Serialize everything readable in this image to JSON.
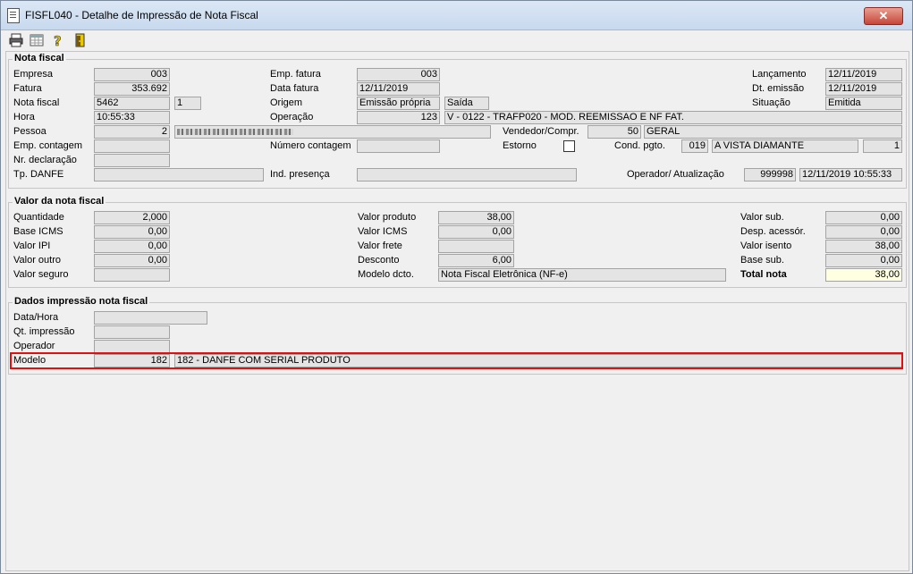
{
  "window": {
    "title": "FISFL040 - Detalhe de Impressão de Nota Fiscal",
    "close": "✕"
  },
  "nf": {
    "section": "Nota fiscal",
    "empresa_l": "Empresa",
    "empresa": "003",
    "fatura_l": "Fatura",
    "fatura": "353.692",
    "nota_l": "Nota fiscal",
    "nota": "5462",
    "nota_serie": "1",
    "hora_l": "Hora",
    "hora": "10:55:33",
    "pessoa_l": "Pessoa",
    "pessoa": "2",
    "empcont_l": "Emp. contagem",
    "nrdecl_l": "Nr. declaração",
    "tpdanfe_l": "Tp. DANFE",
    "empfat_l": "Emp. fatura",
    "empfat": "003",
    "datafat_l": "Data fatura",
    "datafat": "12/11/2019",
    "origem_l": "Origem",
    "origem": "Emissão própria",
    "origem2": "Saída",
    "operacao_l": "Operação",
    "operacao": "123",
    "operacao_desc": "V - 0122 - TRAFP020 - MOD. REEMISSAO  E NF FAT.",
    "numcont_l": "Número contagem",
    "indpres_l": "Ind. presença",
    "vendedor_l": "Vendedor/Compr.",
    "vendedor": "50",
    "vendedor_desc": "GERAL",
    "estorno_l": "Estorno",
    "condpgto_l": "Cond. pgto.",
    "condpgto": "019",
    "condpgto_desc": "A VISTA DIAMANTE",
    "condpgto_n": "1",
    "lanc_l": "Lançamento",
    "lanc": "12/11/2019",
    "dtemis_l": "Dt. emissão",
    "dtemis": "12/11/2019",
    "sit_l": "Situação",
    "sit": "Emitida",
    "oper_l": "Operador/ Atualização",
    "oper": "999998",
    "oper_dt": "12/11/2019 10:55:33"
  },
  "valor": {
    "section": "Valor da nota fiscal",
    "qtd_l": "Quantidade",
    "qtd": "2,000",
    "bicms_l": "Base ICMS",
    "bicms": "0,00",
    "ipi_l": "Valor IPI",
    "ipi": "0,00",
    "outro_l": "Valor outro",
    "outro": "0,00",
    "seguro_l": "Valor seguro",
    "prod_l": "Valor produto",
    "prod": "38,00",
    "vicms_l": "Valor ICMS",
    "vicms": "0,00",
    "frete_l": "Valor frete",
    "desc_l": "Desconto",
    "desc": "6,00",
    "modelo_l": "Modelo dcto.",
    "modelo": "Nota Fiscal Eletrônica (NF-e)",
    "sub_l": "Valor sub.",
    "sub": "0,00",
    "despac_l": "Desp. acessór.",
    "despac": "0,00",
    "isento_l": "Valor isento",
    "isento": "38,00",
    "basesub_l": "Base sub.",
    "basesub": "0,00",
    "total_l": "Total nota",
    "total": "38,00"
  },
  "imp": {
    "section": "Dados impressão nota fiscal",
    "dh_l": "Data/Hora",
    "qt_l": "Qt. impressão",
    "op_l": "Operador",
    "mod_l": "Modelo",
    "mod": "182",
    "mod_desc": "182 - DANFE COM SERIAL PRODUTO"
  }
}
